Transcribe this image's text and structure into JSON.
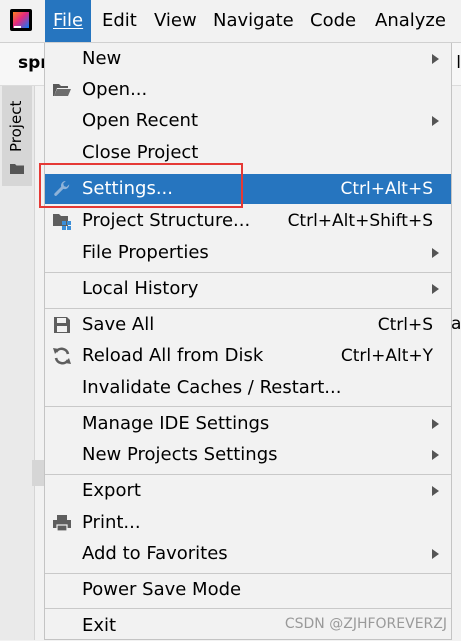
{
  "menubar": {
    "logo": "intellij-idea-logo",
    "items": [
      {
        "label": "File",
        "active": true
      },
      {
        "label": "Edit"
      },
      {
        "label": "View"
      },
      {
        "label": "Navigate"
      },
      {
        "label": "Code"
      },
      {
        "label": "Analyze"
      }
    ]
  },
  "toolbar": {
    "project_name": "spr",
    "tail_text": "l"
  },
  "left_panel": {
    "tab_label": "Project",
    "tab_icon": "folder-icon"
  },
  "background_fragments": [
    "a"
  ],
  "file_menu": {
    "items": [
      {
        "label": "New",
        "shortcut": "",
        "submenu": true,
        "icon": ""
      },
      {
        "label": "Open...",
        "shortcut": "",
        "submenu": false,
        "icon": "folder-open-icon"
      },
      {
        "label": "Open Recent",
        "shortcut": "",
        "submenu": true,
        "icon": ""
      },
      {
        "label": "Close Project",
        "shortcut": "",
        "submenu": false,
        "icon": ""
      },
      {
        "label": "Settings...",
        "shortcut": "Ctrl+Alt+S",
        "submenu": false,
        "icon": "wrench-icon",
        "selected": true
      },
      {
        "label": "Project Structure...",
        "shortcut": "Ctrl+Alt+Shift+S",
        "submenu": false,
        "icon": "project-structure-icon"
      },
      {
        "label": "File Properties",
        "shortcut": "",
        "submenu": true,
        "icon": ""
      },
      {
        "label": "Local History",
        "shortcut": "",
        "submenu": true,
        "icon": ""
      },
      {
        "label": "Save All",
        "shortcut": "Ctrl+S",
        "submenu": false,
        "icon": "save-icon"
      },
      {
        "label": "Reload All from Disk",
        "shortcut": "Ctrl+Alt+Y",
        "submenu": false,
        "icon": "reload-icon"
      },
      {
        "label": "Invalidate Caches / Restart...",
        "shortcut": "",
        "submenu": false,
        "icon": ""
      },
      {
        "label": "Manage IDE Settings",
        "shortcut": "",
        "submenu": true,
        "icon": ""
      },
      {
        "label": "New Projects Settings",
        "shortcut": "",
        "submenu": true,
        "icon": ""
      },
      {
        "label": "Export",
        "shortcut": "",
        "submenu": true,
        "icon": ""
      },
      {
        "label": "Print...",
        "shortcut": "",
        "submenu": false,
        "icon": "printer-icon"
      },
      {
        "label": "Add to Favorites",
        "shortcut": "",
        "submenu": true,
        "icon": ""
      },
      {
        "label": "Power Save Mode",
        "shortcut": "",
        "submenu": false,
        "icon": ""
      },
      {
        "label": "Exit",
        "shortcut": "",
        "submenu": false,
        "icon": ""
      }
    ]
  },
  "colors": {
    "selection": "#2675bf",
    "highlight_box": "#e53935",
    "menu_bg": "#f2f2f2"
  },
  "watermark": "CSDN @ZJHFOREVERZJ"
}
